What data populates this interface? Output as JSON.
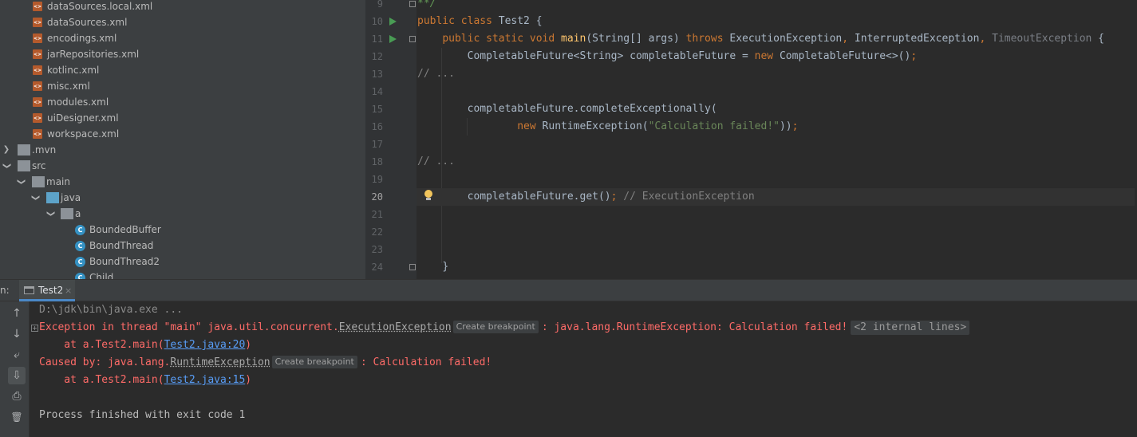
{
  "project_tree": {
    "items": [
      {
        "label": "dataSources.local.xml",
        "type": "xml"
      },
      {
        "label": "dataSources.xml",
        "type": "xml"
      },
      {
        "label": "encodings.xml",
        "type": "xml"
      },
      {
        "label": "jarRepositories.xml",
        "type": "xml"
      },
      {
        "label": "kotlinc.xml",
        "type": "xml"
      },
      {
        "label": "misc.xml",
        "type": "xml"
      },
      {
        "label": "modules.xml",
        "type": "xml"
      },
      {
        "label": "uiDesigner.xml",
        "type": "xml"
      },
      {
        "label": "workspace.xml",
        "type": "xml"
      },
      {
        "label": ".mvn",
        "type": "folder",
        "expanded": false
      },
      {
        "label": "src",
        "type": "folder",
        "expanded": true
      },
      {
        "label": "main",
        "type": "folder",
        "expanded": true
      },
      {
        "label": "java",
        "type": "source-folder",
        "expanded": true
      },
      {
        "label": "a",
        "type": "package",
        "expanded": true
      },
      {
        "label": "BoundedBuffer",
        "type": "class"
      },
      {
        "label": "BoundThread",
        "type": "class"
      },
      {
        "label": "BoundThread2",
        "type": "class"
      },
      {
        "label": "Child",
        "type": "class"
      }
    ]
  },
  "editor": {
    "line_numbers": [
      "9",
      "10",
      "11",
      "12",
      "13",
      "14",
      "15",
      "16",
      "17",
      "18",
      "19",
      "20",
      "21",
      "22",
      "23",
      "24"
    ],
    "current_line": "20",
    "code": {
      "l9": "**/",
      "l10_kw": "public class",
      "l10_rest": " Test2 {",
      "l11_kw1": "public static void",
      "l11_fn": "main",
      "l11_a": "(String[] args) ",
      "l11_kw2": "throws",
      "l11_b": " ExecutionException",
      "l11_c": ", ",
      "l11_d": "InterruptedException",
      "l11_e": ", ",
      "l11_f": "TimeoutException",
      "l11_g": " {",
      "l12_a": "CompletableFuture<String> completableFuture = ",
      "l12_kw": "new",
      "l12_b": " CompletableFuture<>()",
      "l12_c": ";",
      "l13": "// ...",
      "l15": "completableFuture.completeExceptionally(",
      "l16_kw": "new",
      "l16_a": " RuntimeException(",
      "l16_str": "\"Calculation failed!\"",
      "l16_b": "))",
      "l16_c": ";",
      "l18": "// ...",
      "l20_a": "completableFuture.get()",
      "l20_b": ";",
      "l20_cmt": " // ExecutionException",
      "l24": "}"
    }
  },
  "run_window": {
    "title_fragment": "n:",
    "tab_label": "Test2",
    "tab_close": "×",
    "toolbar": {
      "up": "↑",
      "down": "↓",
      "wrap": "⤶",
      "scroll_end": "⇩",
      "print": "⎙",
      "trash": "🗑"
    },
    "console": {
      "cmd": "D:\\jdk\\bin\\java.exe ...",
      "exc_a": "Exception in thread \"main\" java.util.concurrent.",
      "exc_cls": "ExecutionException",
      "exc_bp": "Create breakpoint",
      "exc_b": ": java.lang.RuntimeException: Calculation failed!",
      "exc_internal": "<2 internal lines>",
      "at1_a": "    at a.Test2.main(",
      "at1_link": "Test2.java:20",
      "at1_b": ")",
      "cause_a": "Caused by: java.lang.",
      "cause_cls": "RuntimeException",
      "cause_bp": "Create breakpoint",
      "cause_b": ": Calculation failed!",
      "at2_a": "    at a.Test2.main(",
      "at2_link": "Test2.java:15",
      "at2_b": ")",
      "exit": "Process finished with exit code 1"
    }
  }
}
